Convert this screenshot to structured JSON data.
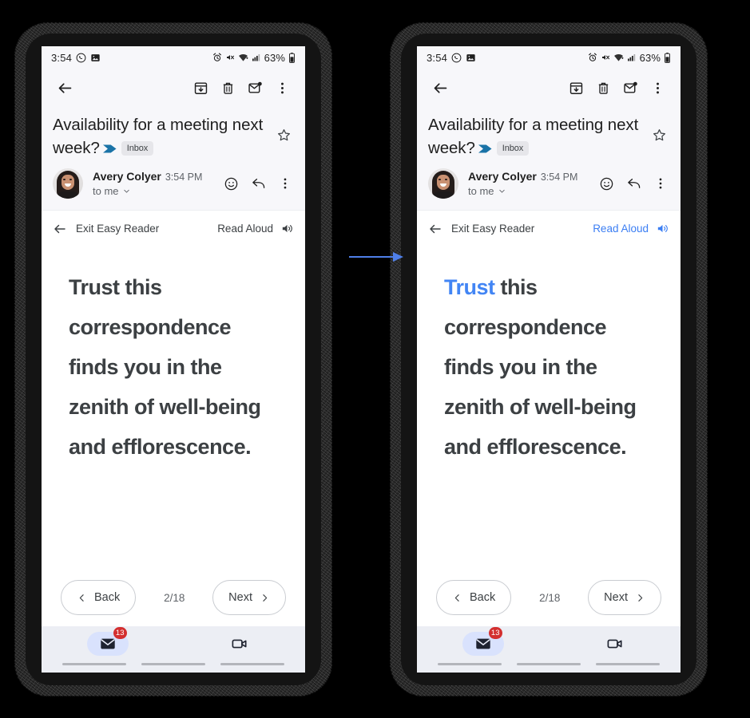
{
  "meta": {
    "accent_blue": "#4285f4",
    "link_blue": "#3b7ef3",
    "badge_red": "#d32f2f",
    "important_marker_color": "#1a73a7",
    "text_dark": "#3c4043",
    "bg_surface": "#f7f7fa",
    "nav_bg": "#eceef4"
  },
  "connector": {
    "name": "flow-arrow",
    "direction": "right"
  },
  "status_bar": {
    "time": "3:54",
    "left_icons": [
      "whatsapp-icon",
      "screenshot-image-icon"
    ],
    "right_icons": [
      "alarm-icon",
      "ringer-off-icon",
      "wifi-icon",
      "cellular-signal-icon"
    ],
    "battery_percent": "63%",
    "battery_icon": "battery-icon"
  },
  "app_toolbar": {
    "back_icon": "back-arrow-icon",
    "actions": [
      {
        "name": "archive-button",
        "icon": "archive-icon"
      },
      {
        "name": "delete-button",
        "icon": "trash-icon"
      },
      {
        "name": "mark-unread-button",
        "icon": "mail-unread-icon"
      },
      {
        "name": "more-options-button",
        "icon": "overflow-menu-icon"
      }
    ]
  },
  "email": {
    "subject": "Availability for a meeting next week?",
    "important_marker": "important-marker-icon",
    "label_chip": "Inbox",
    "star_icon": "star-outline-icon",
    "sender_name": "Avery Colyer",
    "sender_time": "3:54 PM",
    "recipient": "to me",
    "recipient_chevron": "chevron-down-icon",
    "avatar": "sender-avatar",
    "actions": [
      {
        "name": "add-reaction-button",
        "icon": "emoji-smile-icon"
      },
      {
        "name": "reply-button",
        "icon": "reply-arrow-icon"
      },
      {
        "name": "message-more-button",
        "icon": "overflow-menu-icon"
      }
    ]
  },
  "reader_bar": {
    "back_icon": "back-arrow-icon",
    "exit_label": "Exit Easy Reader",
    "read_aloud_label": "Read Aloud",
    "speaker_icon": "speaker-volume-icon"
  },
  "reader_body": {
    "full_text": "Trust this correspondence finds you in the zenith of well-being and efflorescence.",
    "highlight_word": "Trust",
    "rest_text": " this correspondence finds you in the zenith of well-being and efflorescence."
  },
  "pager": {
    "back_label": "Back",
    "back_icon": "chevron-left-icon",
    "count": "2/18",
    "next_label": "Next",
    "next_icon": "chevron-right-icon"
  },
  "bottom_nav": {
    "items": [
      {
        "name": "nav-mail",
        "icon": "mail-icon",
        "badge": "13",
        "selected": true
      },
      {
        "name": "nav-meet",
        "icon": "video-camera-icon",
        "badge": "",
        "selected": false
      }
    ]
  },
  "panels": [
    {
      "id": "left",
      "name": "phone-before",
      "read_aloud_active": false,
      "word_highlighted": false
    },
    {
      "id": "right",
      "name": "phone-after",
      "read_aloud_active": true,
      "word_highlighted": true
    }
  ]
}
